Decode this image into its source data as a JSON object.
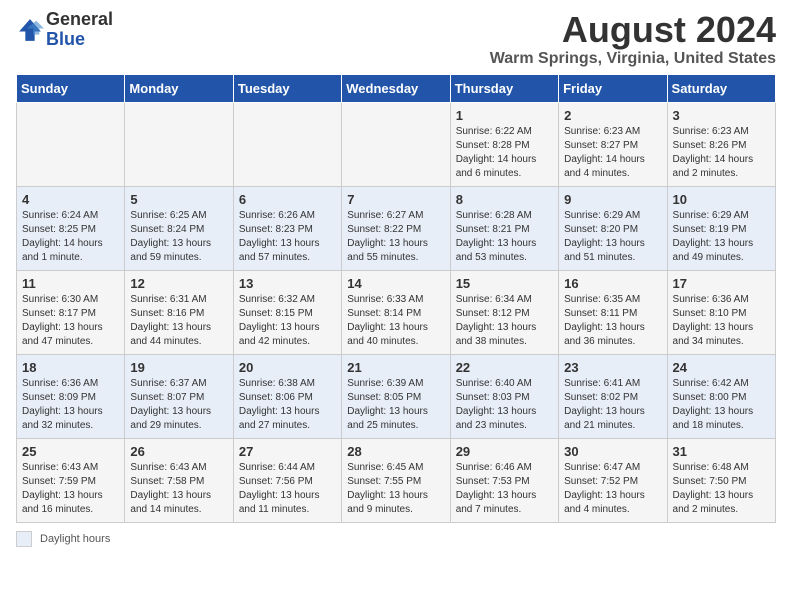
{
  "logo": {
    "general": "General",
    "blue": "Blue"
  },
  "title": "August 2024",
  "location": "Warm Springs, Virginia, United States",
  "legend": {
    "label": "Daylight hours"
  },
  "weekdays": [
    "Sunday",
    "Monday",
    "Tuesday",
    "Wednesday",
    "Thursday",
    "Friday",
    "Saturday"
  ],
  "weeks": [
    [
      {
        "day": "",
        "sunrise": "",
        "sunset": "",
        "daylight": ""
      },
      {
        "day": "",
        "sunrise": "",
        "sunset": "",
        "daylight": ""
      },
      {
        "day": "",
        "sunrise": "",
        "sunset": "",
        "daylight": ""
      },
      {
        "day": "",
        "sunrise": "",
        "sunset": "",
        "daylight": ""
      },
      {
        "day": "1",
        "sunrise": "Sunrise: 6:22 AM",
        "sunset": "Sunset: 8:28 PM",
        "daylight": "Daylight: 14 hours and 6 minutes."
      },
      {
        "day": "2",
        "sunrise": "Sunrise: 6:23 AM",
        "sunset": "Sunset: 8:27 PM",
        "daylight": "Daylight: 14 hours and 4 minutes."
      },
      {
        "day": "3",
        "sunrise": "Sunrise: 6:23 AM",
        "sunset": "Sunset: 8:26 PM",
        "daylight": "Daylight: 14 hours and 2 minutes."
      }
    ],
    [
      {
        "day": "4",
        "sunrise": "Sunrise: 6:24 AM",
        "sunset": "Sunset: 8:25 PM",
        "daylight": "Daylight: 14 hours and 1 minute."
      },
      {
        "day": "5",
        "sunrise": "Sunrise: 6:25 AM",
        "sunset": "Sunset: 8:24 PM",
        "daylight": "Daylight: 13 hours and 59 minutes."
      },
      {
        "day": "6",
        "sunrise": "Sunrise: 6:26 AM",
        "sunset": "Sunset: 8:23 PM",
        "daylight": "Daylight: 13 hours and 57 minutes."
      },
      {
        "day": "7",
        "sunrise": "Sunrise: 6:27 AM",
        "sunset": "Sunset: 8:22 PM",
        "daylight": "Daylight: 13 hours and 55 minutes."
      },
      {
        "day": "8",
        "sunrise": "Sunrise: 6:28 AM",
        "sunset": "Sunset: 8:21 PM",
        "daylight": "Daylight: 13 hours and 53 minutes."
      },
      {
        "day": "9",
        "sunrise": "Sunrise: 6:29 AM",
        "sunset": "Sunset: 8:20 PM",
        "daylight": "Daylight: 13 hours and 51 minutes."
      },
      {
        "day": "10",
        "sunrise": "Sunrise: 6:29 AM",
        "sunset": "Sunset: 8:19 PM",
        "daylight": "Daylight: 13 hours and 49 minutes."
      }
    ],
    [
      {
        "day": "11",
        "sunrise": "Sunrise: 6:30 AM",
        "sunset": "Sunset: 8:17 PM",
        "daylight": "Daylight: 13 hours and 47 minutes."
      },
      {
        "day": "12",
        "sunrise": "Sunrise: 6:31 AM",
        "sunset": "Sunset: 8:16 PM",
        "daylight": "Daylight: 13 hours and 44 minutes."
      },
      {
        "day": "13",
        "sunrise": "Sunrise: 6:32 AM",
        "sunset": "Sunset: 8:15 PM",
        "daylight": "Daylight: 13 hours and 42 minutes."
      },
      {
        "day": "14",
        "sunrise": "Sunrise: 6:33 AM",
        "sunset": "Sunset: 8:14 PM",
        "daylight": "Daylight: 13 hours and 40 minutes."
      },
      {
        "day": "15",
        "sunrise": "Sunrise: 6:34 AM",
        "sunset": "Sunset: 8:12 PM",
        "daylight": "Daylight: 13 hours and 38 minutes."
      },
      {
        "day": "16",
        "sunrise": "Sunrise: 6:35 AM",
        "sunset": "Sunset: 8:11 PM",
        "daylight": "Daylight: 13 hours and 36 minutes."
      },
      {
        "day": "17",
        "sunrise": "Sunrise: 6:36 AM",
        "sunset": "Sunset: 8:10 PM",
        "daylight": "Daylight: 13 hours and 34 minutes."
      }
    ],
    [
      {
        "day": "18",
        "sunrise": "Sunrise: 6:36 AM",
        "sunset": "Sunset: 8:09 PM",
        "daylight": "Daylight: 13 hours and 32 minutes."
      },
      {
        "day": "19",
        "sunrise": "Sunrise: 6:37 AM",
        "sunset": "Sunset: 8:07 PM",
        "daylight": "Daylight: 13 hours and 29 minutes."
      },
      {
        "day": "20",
        "sunrise": "Sunrise: 6:38 AM",
        "sunset": "Sunset: 8:06 PM",
        "daylight": "Daylight: 13 hours and 27 minutes."
      },
      {
        "day": "21",
        "sunrise": "Sunrise: 6:39 AM",
        "sunset": "Sunset: 8:05 PM",
        "daylight": "Daylight: 13 hours and 25 minutes."
      },
      {
        "day": "22",
        "sunrise": "Sunrise: 6:40 AM",
        "sunset": "Sunset: 8:03 PM",
        "daylight": "Daylight: 13 hours and 23 minutes."
      },
      {
        "day": "23",
        "sunrise": "Sunrise: 6:41 AM",
        "sunset": "Sunset: 8:02 PM",
        "daylight": "Daylight: 13 hours and 21 minutes."
      },
      {
        "day": "24",
        "sunrise": "Sunrise: 6:42 AM",
        "sunset": "Sunset: 8:00 PM",
        "daylight": "Daylight: 13 hours and 18 minutes."
      }
    ],
    [
      {
        "day": "25",
        "sunrise": "Sunrise: 6:43 AM",
        "sunset": "Sunset: 7:59 PM",
        "daylight": "Daylight: 13 hours and 16 minutes."
      },
      {
        "day": "26",
        "sunrise": "Sunrise: 6:43 AM",
        "sunset": "Sunset: 7:58 PM",
        "daylight": "Daylight: 13 hours and 14 minutes."
      },
      {
        "day": "27",
        "sunrise": "Sunrise: 6:44 AM",
        "sunset": "Sunset: 7:56 PM",
        "daylight": "Daylight: 13 hours and 11 minutes."
      },
      {
        "day": "28",
        "sunrise": "Sunrise: 6:45 AM",
        "sunset": "Sunset: 7:55 PM",
        "daylight": "Daylight: 13 hours and 9 minutes."
      },
      {
        "day": "29",
        "sunrise": "Sunrise: 6:46 AM",
        "sunset": "Sunset: 7:53 PM",
        "daylight": "Daylight: 13 hours and 7 minutes."
      },
      {
        "day": "30",
        "sunrise": "Sunrise: 6:47 AM",
        "sunset": "Sunset: 7:52 PM",
        "daylight": "Daylight: 13 hours and 4 minutes."
      },
      {
        "day": "31",
        "sunrise": "Sunrise: 6:48 AM",
        "sunset": "Sunset: 7:50 PM",
        "daylight": "Daylight: 13 hours and 2 minutes."
      }
    ]
  ]
}
